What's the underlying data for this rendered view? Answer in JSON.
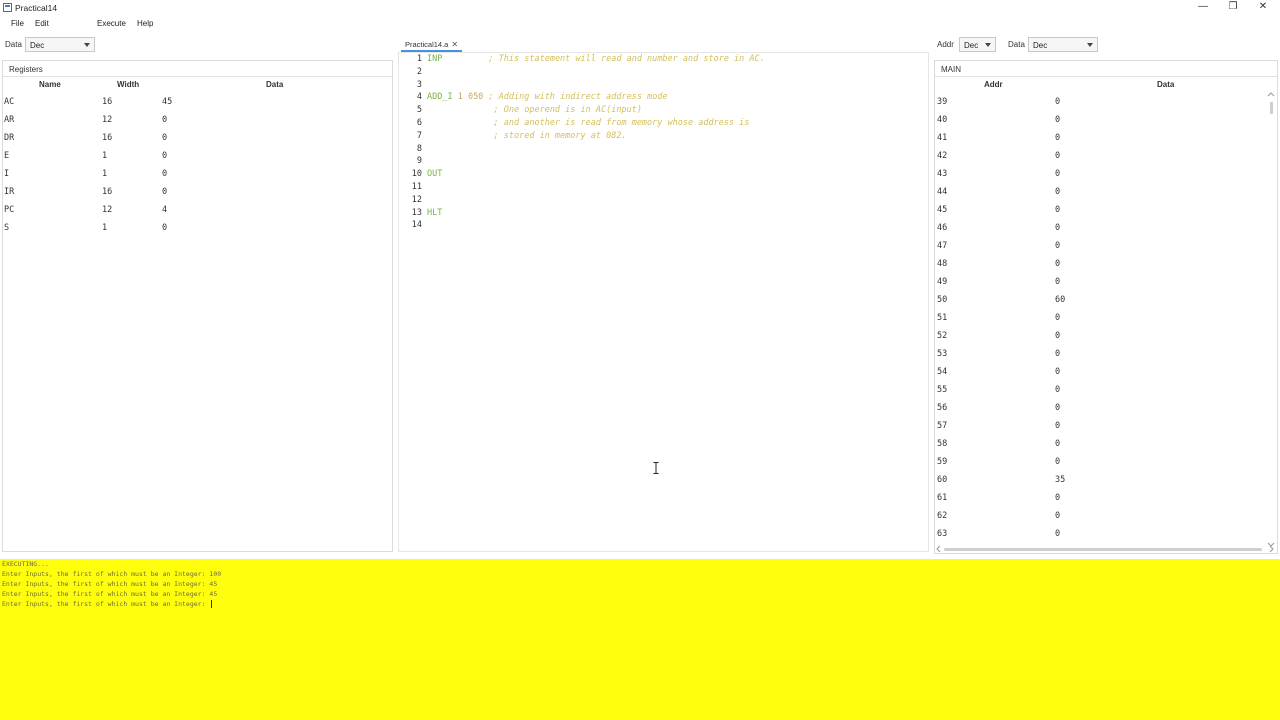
{
  "window": {
    "title": "Practical14",
    "controls": {
      "minimize": "—",
      "maximize": "❐",
      "close": "✕"
    }
  },
  "menu": {
    "file": "File",
    "edit": "Edit",
    "execute": "Execute",
    "help": "Help"
  },
  "registers": {
    "toolbar_label": "Data",
    "format": "Dec",
    "title": "Registers",
    "columns": {
      "name": "Name",
      "width": "Width",
      "data": "Data"
    },
    "rows": [
      {
        "name": "AC",
        "width": "16",
        "data": "45"
      },
      {
        "name": "AR",
        "width": "12",
        "data": "0"
      },
      {
        "name": "DR",
        "width": "16",
        "data": "0"
      },
      {
        "name": "E",
        "width": "1",
        "data": "0"
      },
      {
        "name": "I",
        "width": "1",
        "data": "0"
      },
      {
        "name": "IR",
        "width": "16",
        "data": "0"
      },
      {
        "name": "PC",
        "width": "12",
        "data": "4"
      },
      {
        "name": "S",
        "width": "1",
        "data": "0"
      }
    ]
  },
  "editor": {
    "tab": {
      "label": "Practical14.a",
      "close": "✕"
    },
    "lines": [
      {
        "n": "1",
        "kw": "INP",
        "arg": "",
        "comment": "         ; This statement will read and number and store in AC."
      },
      {
        "n": "2",
        "kw": "",
        "arg": "",
        "comment": ""
      },
      {
        "n": "3",
        "kw": "",
        "arg": "",
        "comment": ""
      },
      {
        "n": "4",
        "kw": "ADD_I",
        "arg": " 1 050",
        "comment": " ; Adding with indirect address mode"
      },
      {
        "n": "5",
        "kw": "",
        "arg": "",
        "comment": "             ; One operend is in AC(input)"
      },
      {
        "n": "6",
        "kw": "",
        "arg": "",
        "comment": "             ; and another is read from memory whose address is"
      },
      {
        "n": "7",
        "kw": "",
        "arg": "",
        "comment": "             ; stored in memory at 082."
      },
      {
        "n": "8",
        "kw": "",
        "arg": "",
        "comment": ""
      },
      {
        "n": "9",
        "kw": "",
        "arg": "",
        "comment": ""
      },
      {
        "n": "10",
        "kw": "OUT",
        "arg": "",
        "comment": ""
      },
      {
        "n": "11",
        "kw": "",
        "arg": "",
        "comment": ""
      },
      {
        "n": "12",
        "kw": "",
        "arg": "",
        "comment": ""
      },
      {
        "n": "13",
        "kw": "HLT",
        "arg": "",
        "comment": ""
      },
      {
        "n": "14",
        "kw": "",
        "arg": "",
        "comment": ""
      }
    ]
  },
  "memory": {
    "addr_label": "Addr",
    "addr_format": "Dec",
    "data_label": "Data",
    "data_format": "Dec",
    "title": "MAIN",
    "columns": {
      "addr": "Addr",
      "data": "Data"
    },
    "rows": [
      {
        "addr": "39",
        "data": "0"
      },
      {
        "addr": "40",
        "data": "0"
      },
      {
        "addr": "41",
        "data": "0"
      },
      {
        "addr": "42",
        "data": "0"
      },
      {
        "addr": "43",
        "data": "0"
      },
      {
        "addr": "44",
        "data": "0"
      },
      {
        "addr": "45",
        "data": "0"
      },
      {
        "addr": "46",
        "data": "0"
      },
      {
        "addr": "47",
        "data": "0"
      },
      {
        "addr": "48",
        "data": "0"
      },
      {
        "addr": "49",
        "data": "0"
      },
      {
        "addr": "50",
        "data": "60"
      },
      {
        "addr": "51",
        "data": "0"
      },
      {
        "addr": "52",
        "data": "0"
      },
      {
        "addr": "53",
        "data": "0"
      },
      {
        "addr": "54",
        "data": "0"
      },
      {
        "addr": "55",
        "data": "0"
      },
      {
        "addr": "56",
        "data": "0"
      },
      {
        "addr": "57",
        "data": "0"
      },
      {
        "addr": "58",
        "data": "0"
      },
      {
        "addr": "59",
        "data": "0"
      },
      {
        "addr": "60",
        "data": "35"
      },
      {
        "addr": "61",
        "data": "0"
      },
      {
        "addr": "62",
        "data": "0"
      },
      {
        "addr": "63",
        "data": "0"
      }
    ]
  },
  "console": {
    "background": "#ffff0d",
    "lines": [
      "EXECUTING...",
      "Enter Inputs, the first of which must be an Integer: 100",
      "Enter Inputs, the first of which must be an Integer: 45",
      "Enter Inputs, the first of which must be an Integer: 45",
      "Enter Inputs, the first of which must be an Integer: "
    ]
  }
}
